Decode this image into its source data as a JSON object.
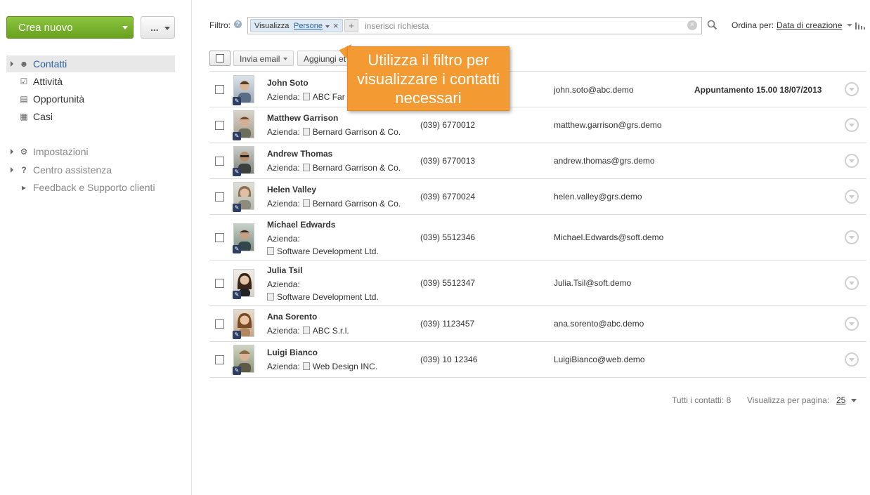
{
  "sidebar": {
    "create_label": "Crea nuovo",
    "more_label": "...",
    "items": [
      {
        "label": "Contatti",
        "icon": "contacts-icon"
      },
      {
        "label": "Attività",
        "icon": "tasks-icon"
      },
      {
        "label": "Opportunità",
        "icon": "opportunity-icon"
      },
      {
        "label": "Casi",
        "icon": "cases-icon"
      }
    ],
    "secondary": [
      {
        "label": "Impostazioni",
        "icon": "gear-icon"
      },
      {
        "label": "Centro assistenza",
        "icon": "help-icon"
      },
      {
        "label": "Feedback e Supporto clienti",
        "icon": "megaphone-icon"
      }
    ]
  },
  "filter": {
    "label": "Filtro:",
    "chip_key": "Visualizza",
    "chip_value": "Persone",
    "placeholder": "inserisci richiesta"
  },
  "sort": {
    "label": "Ordina per:",
    "value": "Data di creazione"
  },
  "toolbar": {
    "send_email": "Invia email",
    "add_to": "Aggiungi et"
  },
  "callout": {
    "text": "Utilizza il filtro per visualizzare i contatti necessari"
  },
  "company_label": "Azienda:",
  "contacts": [
    {
      "name": "John Soto",
      "company": "ABC Far",
      "phone": "",
      "email": "john.soto@abc.demo",
      "activity": "Appuntamento 15.00 18/07/2013"
    },
    {
      "name": "Matthew Garrison",
      "company": "Bernard Garrison & Co.",
      "phone": "(039) 6770012",
      "email": "matthew.garrison@grs.demo",
      "activity": ""
    },
    {
      "name": "Andrew Thomas",
      "company": "Bernard Garrison & Co.",
      "phone": "(039) 6770013",
      "email": "andrew.thomas@grs.demo",
      "activity": ""
    },
    {
      "name": "Helen Valley",
      "company": "Bernard Garrison & Co.",
      "phone": "(039) 6770024",
      "email": "helen.valley@grs.demo",
      "activity": ""
    },
    {
      "name": "Michael Edwards",
      "company": "Software Development Ltd.",
      "phone": "(039) 5512346",
      "email": "Michael.Edwards@soft.demo",
      "activity": ""
    },
    {
      "name": "Julia Tsil",
      "company": "Software Development Ltd.",
      "phone": "(039) 5512347",
      "email": "Julia.Tsil@soft.demo",
      "activity": ""
    },
    {
      "name": "Ana Sorento",
      "company": "ABC S.r.l.",
      "phone": "(039) 1123457",
      "email": "ana.sorento@abc.demo",
      "activity": ""
    },
    {
      "name": "Luigi Bianco",
      "company": "Web Design INC.",
      "phone": "(039) 10 12346",
      "email": "LuigiBianco@web.demo",
      "activity": ""
    }
  ],
  "footer": {
    "total": "Tutti i contatti: 8",
    "per_page_label": "Visualizza per pagina:",
    "per_page_value": "25"
  },
  "colors": {
    "accent_green": "#7ab22e",
    "link_blue": "#2a65a0",
    "callout_orange": "#f39a33"
  }
}
